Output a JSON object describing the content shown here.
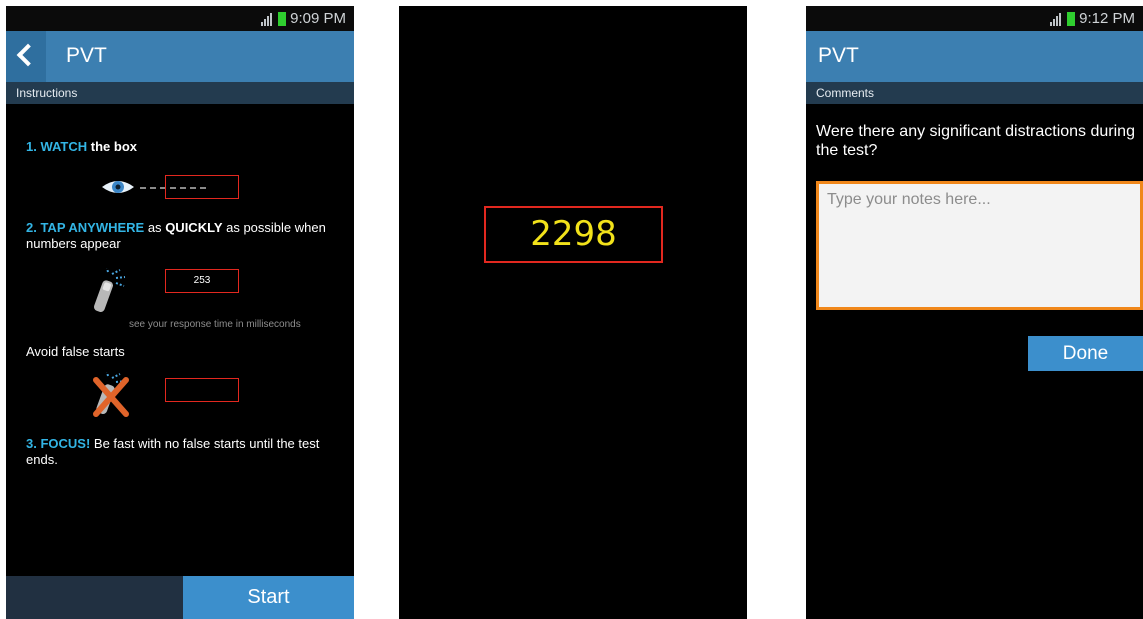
{
  "screen1": {
    "status": {
      "time": "9:09 PM",
      "icons": [
        "signal-icon",
        "battery-icon"
      ]
    },
    "title": "PVT",
    "subheader": "Instructions",
    "step1": {
      "prefix": "1. WATCH",
      "rest": " the box"
    },
    "step2": {
      "prefix": "2. TAP ANYWHERE",
      "mid": " as ",
      "bold": "QUICKLY",
      "rest": " as possible when numbers appear"
    },
    "sample_time": "253",
    "caption": "see your response time in milliseconds",
    "false_starts": "Avoid false starts",
    "step3": {
      "prefix": "3. FOCUS!",
      "rest": " Be fast with no false starts until the test ends."
    },
    "start_label": "Start"
  },
  "screen2": {
    "counter": "2298"
  },
  "screen3": {
    "status": {
      "time": "9:12 PM",
      "icons": [
        "signal-icon",
        "battery-icon"
      ]
    },
    "title": "PVT",
    "subheader": "Comments",
    "question": "Were there any significant distractions during the test?",
    "notes_placeholder": "Type your notes here...",
    "done_label": "Done"
  },
  "colors": {
    "accent": "#3c7fb1",
    "button": "#3c8fcc",
    "highlight": "#33b5e5",
    "box_red": "#e2281f",
    "counter_yellow": "#f2e21a",
    "input_border": "#f0871a"
  }
}
